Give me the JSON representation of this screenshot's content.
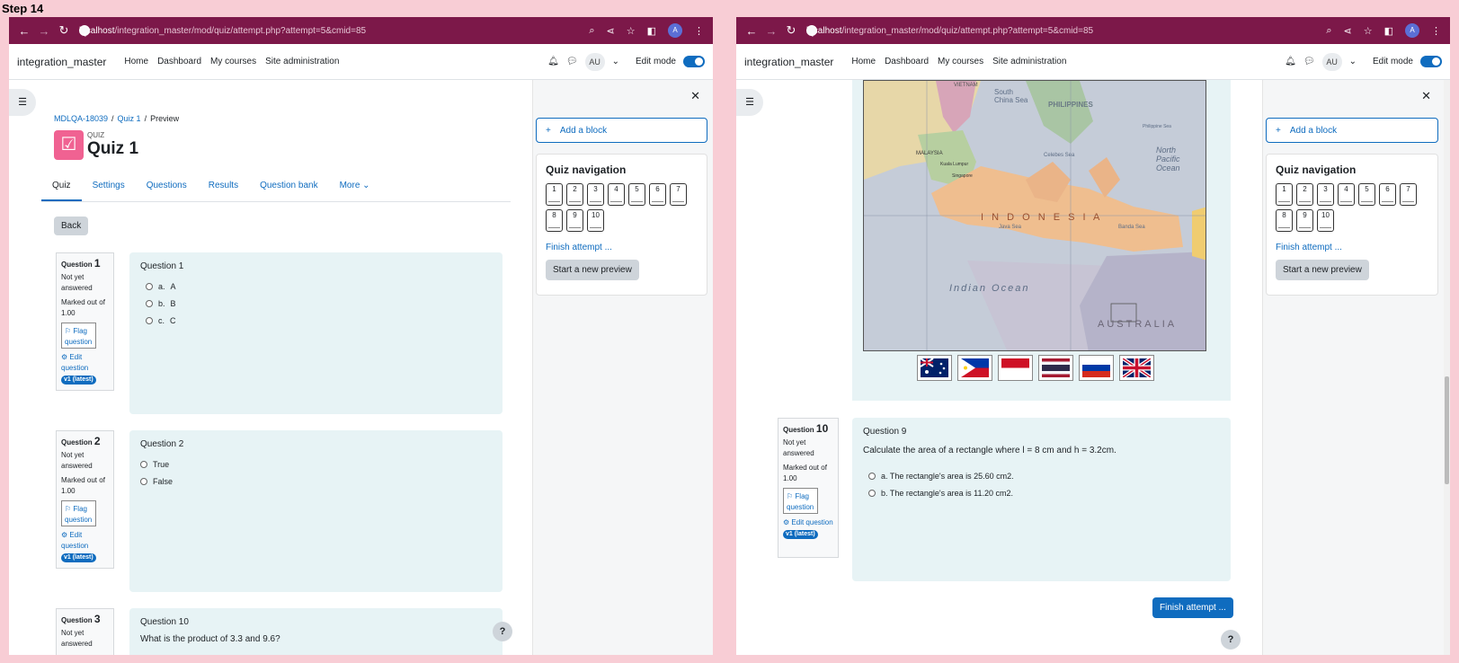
{
  "step_label": "Step 14",
  "browser": {
    "host": "localhost",
    "path": "/integration_master/mod/quiz/attempt.php?attempt=5&cmid=85",
    "avatar": "A"
  },
  "site": {
    "brand": "integration_master",
    "menu": [
      "Home",
      "Dashboard",
      "My courses",
      "Site administration"
    ],
    "user_initials": "AU",
    "edit_mode": "Edit mode"
  },
  "left": {
    "breadcrumb": [
      "MDLQA-18039",
      "Quiz 1",
      "Preview"
    ],
    "quiz_label": "QUIZ",
    "quiz_title": "Quiz 1",
    "tabs": [
      "Quiz",
      "Settings",
      "Questions",
      "Results",
      "Question bank",
      "More"
    ],
    "back": "Back",
    "q1": {
      "label": "Question",
      "num": "1",
      "status": "Not yet answered",
      "marked": "Marked out of 1.00",
      "flag": "Flag question",
      "edit": "Edit question",
      "version": "v1 (latest)",
      "title": "Question 1",
      "options": [
        {
          "l": "a.",
          "t": "A"
        },
        {
          "l": "b.",
          "t": "B"
        },
        {
          "l": "c.",
          "t": "C"
        }
      ]
    },
    "q2": {
      "label": "Question",
      "num": "2",
      "status": "Not yet answered",
      "marked": "Marked out of 1.00",
      "flag": "Flag question",
      "edit": "Edit question",
      "version": "v1 (latest)",
      "title": "Question 2",
      "options": [
        "True",
        "False"
      ]
    },
    "q3": {
      "label": "Question",
      "num": "3",
      "status": "Not yet answered",
      "title": "Question 10",
      "text": "What is the product of 3.3 and 9.6?"
    }
  },
  "right": {
    "map": {
      "labels": [
        "VIETNAM",
        "South China Sea",
        "PHILIPPINES",
        "North Pacific Ocean",
        "MALAYSIA",
        "Kuala Lumpur",
        "Singapore",
        "I N D O N E S I A",
        "Banda Sea",
        "Indian Ocean",
        "AUSTRALIA",
        "Philippine Sea",
        "Celebes Sea",
        "Java Sea"
      ]
    },
    "q10": {
      "label": "Question",
      "num": "10",
      "status": "Not yet answered",
      "marked": "Marked out of 1.00",
      "flag": "Flag question",
      "edit": "Edit question",
      "version": "v1 (latest)",
      "title": "Question 9",
      "text": "Calculate the area of a rectangle where l = 8 cm  and h = 3.2cm.",
      "options": [
        "a. The rectangle's area is 25.60 cm2.",
        "b. The rectangle's area is 11.20 cm2."
      ]
    },
    "finish_btn": "Finish attempt ..."
  },
  "block": {
    "add": "Add a block",
    "nav_title": "Quiz navigation",
    "buttons": [
      "1",
      "2",
      "3",
      "4",
      "5",
      "6",
      "7",
      "8",
      "9",
      "10"
    ],
    "finish": "Finish attempt ...",
    "new_preview": "Start a new preview"
  },
  "help": "?",
  "colors": {
    "chrome": "#7c1849",
    "link": "#0f6cbf",
    "question_bg": "#e7f3f5",
    "quiz_icon": "#f06292"
  }
}
